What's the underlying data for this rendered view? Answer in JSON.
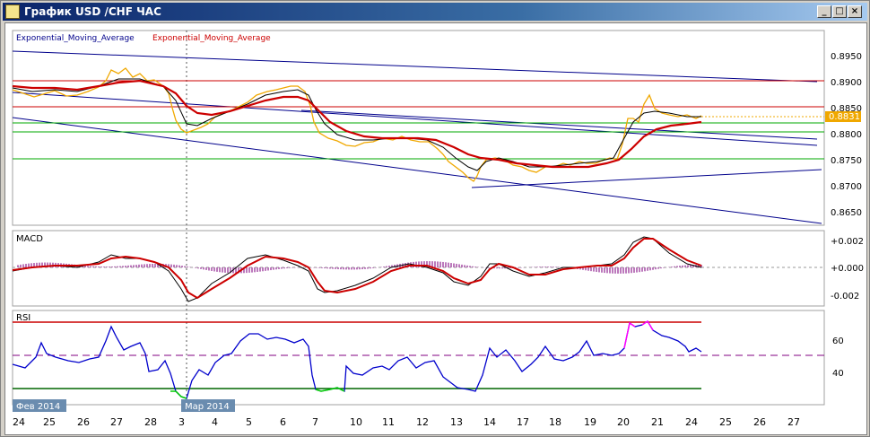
{
  "window": {
    "title": "График USD /CHF ЧАС"
  },
  "main_panel": {
    "indicator_label_1": "Exponential_Moving_Average",
    "indicator_label_2": "Exponential_Moving_Average",
    "price_ticks": [
      "0.8950",
      "0.8900",
      "0.8850",
      "0.8800",
      "0.8750",
      "0.8700",
      "0.8650"
    ],
    "current_price": "0.8831",
    "colors": {
      "price": "#f0a800",
      "ema_slow": "#cc0000",
      "ema_fast": "#000000",
      "trendline": "#00008b",
      "level_red": "#cc0000",
      "level_green": "#00aa00",
      "current_price_bg": "#f0a800"
    }
  },
  "macd_panel": {
    "label": "MACD",
    "ticks": [
      "+0.002",
      "+0.000",
      "-0.002"
    ]
  },
  "rsi_panel": {
    "label": "RSI",
    "ticks": [
      "60",
      "40"
    ],
    "colors": {
      "rsi": "#0000cc",
      "overbought": "#ff00ff",
      "oversold": "#00cc00"
    }
  },
  "time_axis": {
    "ticks": [
      "24",
      "25",
      "26",
      "27",
      "28",
      "3",
      "4",
      "5",
      "6",
      "7",
      "10",
      "11",
      "12",
      "13",
      "14",
      "17",
      "18",
      "19",
      "20",
      "21",
      "24",
      "25",
      "26",
      "27"
    ],
    "month_labels": [
      "Фев 2014",
      "Мар 2014"
    ]
  }
}
